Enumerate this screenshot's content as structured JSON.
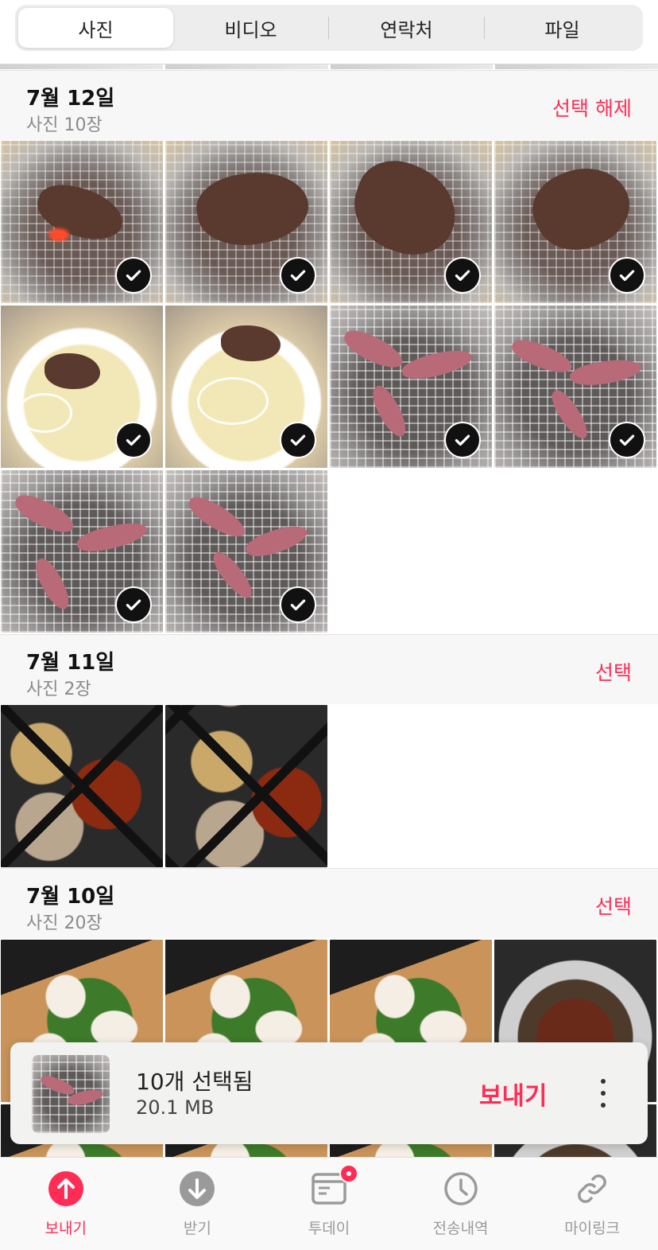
{
  "segments": {
    "items": [
      "사진",
      "비디오",
      "연락처",
      "파일"
    ],
    "active": "사진"
  },
  "sections": [
    {
      "date": "7월 12일",
      "count": "사진 10장",
      "action": "선택 해제"
    },
    {
      "date": "7월 11일",
      "count": "사진 2장",
      "action": "선택"
    },
    {
      "date": "7월 10일",
      "count": "사진 20장",
      "action": "선택"
    }
  ],
  "selection_bar": {
    "title": "10개 선택됨",
    "size": "20.1 MB",
    "send_label": "보내기"
  },
  "tabbar": {
    "items": [
      {
        "label": "보내기",
        "icon": "send-up-arrow-icon",
        "active": true
      },
      {
        "label": "받기",
        "icon": "receive-down-arrow-icon",
        "active": false
      },
      {
        "label": "투데이",
        "icon": "today-card-icon",
        "active": false,
        "badge": true
      },
      {
        "label": "전송내역",
        "icon": "clock-history-icon",
        "active": false
      },
      {
        "label": "마이링크",
        "icon": "link-icon",
        "active": false
      }
    ]
  },
  "colors": {
    "accent": "#ff2d55",
    "section_bg": "#f7f7f7",
    "muted_text": "#8a8a8a"
  }
}
